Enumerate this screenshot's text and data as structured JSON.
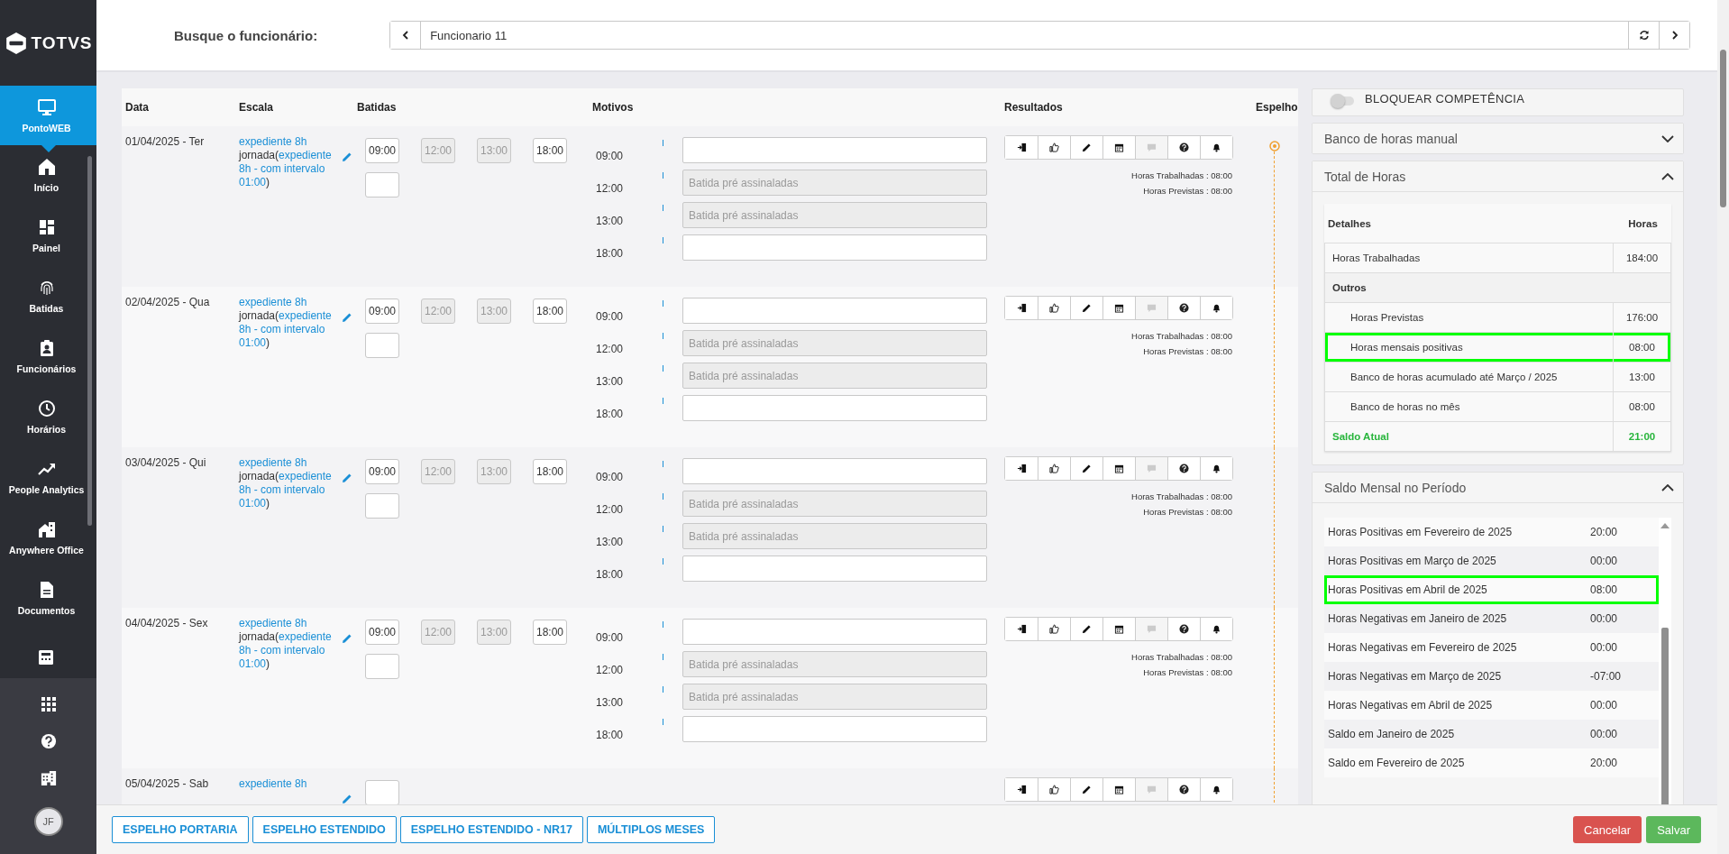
{
  "sidebar": {
    "logo": "TOTVS",
    "items": [
      {
        "label": "PontoWEB",
        "selected": true
      },
      {
        "label": "Início",
        "selected": false
      },
      {
        "label": "Painel",
        "selected": false
      },
      {
        "label": "Batidas",
        "selected": false
      },
      {
        "label": "Funcionários",
        "selected": false
      },
      {
        "label": "Horários",
        "selected": false
      },
      {
        "label": "People Analytics",
        "selected": false
      },
      {
        "label": "Anywhere Office",
        "selected": false
      },
      {
        "label": "Documentos",
        "selected": false
      }
    ],
    "avatar": "JF"
  },
  "search": {
    "label": "Busque o funcionário:",
    "employee": "Funcionario 11"
  },
  "result_actions": [
    {
      "kind": "exit",
      "disabled": false
    },
    {
      "kind": "like",
      "disabled": false
    },
    {
      "kind": "edit",
      "disabled": false
    },
    {
      "kind": "calendar",
      "disabled": false
    },
    {
      "kind": "comment",
      "disabled": true
    },
    {
      "kind": "help",
      "disabled": false
    },
    {
      "kind": "bell",
      "disabled": false
    }
  ],
  "table": {
    "columns": [
      "Data",
      "Escala",
      "Batidas",
      "Motivos",
      "Resultados",
      "Espelho"
    ],
    "rows": [
      {
        "date": "01/04/2025 - Ter",
        "schedule": "expediente 8h",
        "journey_prefix": "jornada(",
        "journey_link": "expediente 8h - com intervalo 01:00",
        "journey_suffix": ")",
        "punches": [
          {
            "value": "09:00",
            "disabled": false
          },
          {
            "value": "12:00",
            "disabled": true
          },
          {
            "value": "13:00",
            "disabled": true
          },
          {
            "value": "18:00",
            "disabled": false
          },
          {
            "disabled": false
          }
        ],
        "reasons": [
          {
            "time": "09:00",
            "disabled": false
          },
          {
            "time": "12:00",
            "placeholder": "Batida pré assinaladas",
            "disabled": true
          },
          {
            "time": "13:00",
            "placeholder": "Batida pré assinaladas",
            "disabled": true
          },
          {
            "time": "18:00",
            "disabled": false
          }
        ],
        "results": [
          "Horas Trabalhadas : 08:00",
          "Horas Previstas : 08:00"
        ],
        "mirror_marker": true
      },
      {
        "date": "02/04/2025 - Qua",
        "schedule": "expediente 8h",
        "journey_prefix": "jornada(",
        "journey_link": "expediente 8h - com intervalo 01:00",
        "journey_suffix": ")",
        "punches": [
          {
            "value": "09:00",
            "disabled": false
          },
          {
            "value": "12:00",
            "disabled": true
          },
          {
            "value": "13:00",
            "disabled": true
          },
          {
            "value": "18:00",
            "disabled": false
          },
          {
            "disabled": false
          }
        ],
        "reasons": [
          {
            "time": "09:00",
            "disabled": false
          },
          {
            "time": "12:00",
            "placeholder": "Batida pré assinaladas",
            "disabled": true
          },
          {
            "time": "13:00",
            "placeholder": "Batida pré assinaladas",
            "disabled": true
          },
          {
            "time": "18:00",
            "disabled": false
          }
        ],
        "results": [
          "Horas Trabalhadas : 08:00",
          "Horas Previstas : 08:00"
        ],
        "mirror_marker": false
      },
      {
        "date": "03/04/2025 - Qui",
        "schedule": "expediente 8h",
        "journey_prefix": "jornada(",
        "journey_link": "expediente 8h - com intervalo 01:00",
        "journey_suffix": ")",
        "punches": [
          {
            "value": "09:00",
            "disabled": false
          },
          {
            "value": "12:00",
            "disabled": true
          },
          {
            "value": "13:00",
            "disabled": true
          },
          {
            "value": "18:00",
            "disabled": false
          },
          {
            "disabled": false
          }
        ],
        "reasons": [
          {
            "time": "09:00",
            "disabled": false
          },
          {
            "time": "12:00",
            "placeholder": "Batida pré assinaladas",
            "disabled": true
          },
          {
            "time": "13:00",
            "placeholder": "Batida pré assinaladas",
            "disabled": true
          },
          {
            "time": "18:00",
            "disabled": false
          }
        ],
        "results": [
          "Horas Trabalhadas : 08:00",
          "Horas Previstas : 08:00"
        ],
        "mirror_marker": false
      },
      {
        "date": "04/04/2025 - Sex",
        "schedule": "expediente 8h",
        "journey_prefix": "jornada(",
        "journey_link": "expediente 8h - com intervalo 01:00",
        "journey_suffix": ")",
        "punches": [
          {
            "value": "09:00",
            "disabled": false
          },
          {
            "value": "12:00",
            "disabled": true
          },
          {
            "value": "13:00",
            "disabled": true
          },
          {
            "value": "18:00",
            "disabled": false
          },
          {
            "disabled": false
          }
        ],
        "reasons": [
          {
            "time": "09:00",
            "disabled": false
          },
          {
            "time": "12:00",
            "placeholder": "Batida pré assinaladas",
            "disabled": true
          },
          {
            "time": "13:00",
            "placeholder": "Batida pré assinaladas",
            "disabled": true
          },
          {
            "time": "18:00",
            "disabled": false
          }
        ],
        "results": [
          "Horas Trabalhadas : 08:00",
          "Horas Previstas : 08:00"
        ],
        "mirror_marker": false
      },
      {
        "date": "05/04/2025 - Sab",
        "schedule": "expediente 8h",
        "punches": [
          {
            "disabled": false
          }
        ],
        "mirror_marker": false
      }
    ]
  },
  "lock": {
    "label": "BLOQUEAR COMPETÊNCIA",
    "on": false
  },
  "manual_bank": {
    "title": "Banco de horas manual",
    "expanded": false
  },
  "total_hours": {
    "title": "Total de Horas",
    "expanded": true,
    "columns": [
      "Detalhes",
      "Horas"
    ],
    "rows": [
      {
        "kind": "item",
        "label": "Horas Trabalhadas",
        "value": "184:00",
        "highlighted": false
      },
      {
        "kind": "group",
        "label": "Outros"
      },
      {
        "kind": "sub",
        "label": "Horas Previstas",
        "value": "176:00",
        "highlighted": false
      },
      {
        "kind": "sub",
        "label": "Horas mensais positivas",
        "value": "08:00",
        "highlighted": true
      },
      {
        "kind": "sub",
        "label": "Banco de horas acumulado até Março / 2025",
        "value": "13:00",
        "highlighted": false
      },
      {
        "kind": "sub",
        "label": "Banco de horas no mês",
        "value": "08:00",
        "highlighted": false
      },
      {
        "kind": "total",
        "label": "Saldo Atual",
        "value": "21:00",
        "highlighted": false
      }
    ]
  },
  "monthly_balance": {
    "title": "Saldo Mensal no Período",
    "expanded": true,
    "rows": [
      {
        "label": "Horas Positivas em Fevereiro de 2025",
        "value": "20:00",
        "highlighted": false
      },
      {
        "label": "Horas Positivas em Março de 2025",
        "value": "00:00",
        "highlighted": false
      },
      {
        "label": "Horas Positivas em Abril de 2025",
        "value": "08:00",
        "highlighted": true
      },
      {
        "label": "Horas Negativas em Janeiro de 2025",
        "value": "00:00",
        "highlighted": false
      },
      {
        "label": "Horas Negativas em Fevereiro de 2025",
        "value": "00:00",
        "highlighted": false
      },
      {
        "label": "Horas Negativas em Março de 2025",
        "value": "-07:00",
        "highlighted": false
      },
      {
        "label": "Horas Negativas em Abril de 2025",
        "value": "00:00",
        "highlighted": false
      },
      {
        "label": "Saldo em Janeiro de 2025",
        "value": "00:00",
        "highlighted": false
      },
      {
        "label": "Saldo em Fevereiro de 2025",
        "value": "20:00",
        "highlighted": false
      }
    ]
  },
  "footer": {
    "report_buttons": [
      "ESPELHO PORTARIA",
      "ESPELHO ESTENDIDO",
      "ESPELHO ESTENDIDO - NR17",
      "MÚLTIPLOS MESES"
    ],
    "cancel": "Cancelar",
    "save": "Salvar"
  }
}
